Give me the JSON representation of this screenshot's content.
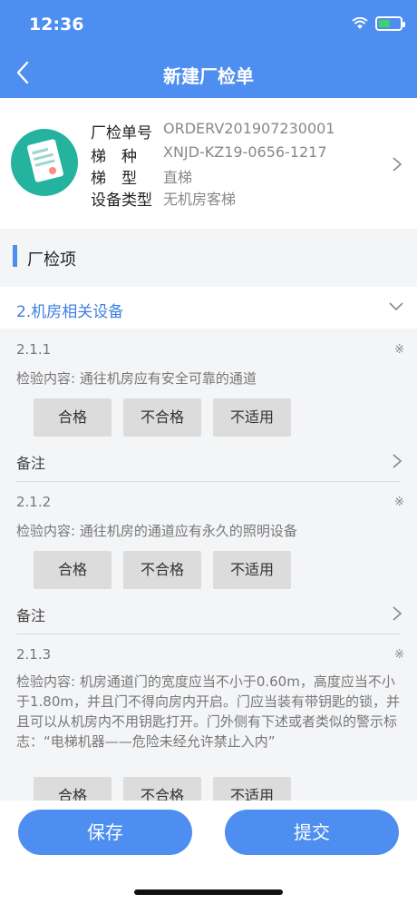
{
  "status_bar": {
    "time": "12:36"
  },
  "header": {
    "title": "新建厂检单"
  },
  "info": {
    "order_label": "厂检单号",
    "order_value": "ORDERV201907230001",
    "elevator_label": "梯　种",
    "elevator_value": "XNJD-KZ19-0656-1217",
    "type_label": "梯　型",
    "type_value": "直梯",
    "device_label": "设备类型",
    "device_value": "无机房客梯"
  },
  "section": {
    "label": "厂检项"
  },
  "group": {
    "label": "2.机房相关设备"
  },
  "options": {
    "pass": "合格",
    "fail": "不合格",
    "na": "不适用"
  },
  "note_label": "备注",
  "required_mark": "※",
  "items": [
    {
      "code": "2.1.1",
      "content": "检验内容: 通往机房应有安全可靠的通道"
    },
    {
      "code": "2.1.2",
      "content": "检验内容: 通往机房的通道应有永久的照明设备"
    },
    {
      "code": "2.1.3",
      "content": "检验内容: 机房通道门的宽度应当不小于0.60m，高度应当不小于1.80m，并且门不得向房内开启。门应当装有带钥匙的锁，并且可以从机房内不用钥匙打开。门外侧有下述或者类似的警示标志：“电梯机器——危险未经允许禁止入内”"
    }
  ],
  "footer": {
    "save": "保存",
    "submit": "提交"
  }
}
